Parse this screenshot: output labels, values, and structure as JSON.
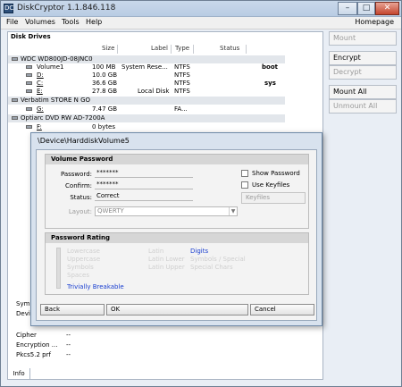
{
  "window": {
    "title": "DiskCryptor 1.1.846.118",
    "icon": "DC",
    "minimize": "–",
    "maximize": "□",
    "close": "✕"
  },
  "menu": {
    "items": [
      "File",
      "Volumes",
      "Tools",
      "Help"
    ],
    "homepage": "Homepage"
  },
  "drives": {
    "label": "Disk Drives",
    "columns": {
      "size": "Size",
      "label": "Label",
      "type": "Type",
      "status": "Status"
    },
    "groups": [
      {
        "name": "WDC WD800JD-08JNC0",
        "volumes": [
          {
            "name": "Volume1",
            "size": "100 MB",
            "label": "System Rese...",
            "type": "NTFS",
            "flag": "boot"
          },
          {
            "name": "D:",
            "size": "10.0 GB",
            "label": "",
            "type": "NTFS",
            "flag": ""
          },
          {
            "name": "C:",
            "size": "36.6 GB",
            "label": "",
            "type": "NTFS",
            "flag": "sys"
          },
          {
            "name": "E:",
            "size": "27.8 GB",
            "label": "Local Disk",
            "type": "NTFS",
            "flag": ""
          }
        ]
      },
      {
        "name": "Verbatim STORE N GO",
        "volumes": [
          {
            "name": "G:",
            "size": "7.47 GB",
            "label": "",
            "type": "FA...",
            "flag": ""
          }
        ]
      },
      {
        "name": "Optiarc DVD RW AD-7200A",
        "volumes": [
          {
            "name": "F:",
            "size": "0 bytes",
            "label": "",
            "type": "",
            "flag": ""
          }
        ]
      }
    ]
  },
  "sidebar": {
    "mount": "Mount",
    "encrypt": "Encrypt",
    "decrypt": "Decrypt",
    "mount_all": "Mount All",
    "unmount_all": "Unmount All"
  },
  "info": {
    "symbolic": "Symb",
    "device": "Devic",
    "cipher": "Cipher",
    "encryption": "Encryption ...",
    "pkcs": "Pkcs5.2 prf",
    "dash": "--",
    "tab": "Info"
  },
  "dialog": {
    "title": "\\Device\\HarddiskVolume5",
    "volume_password": {
      "header": "Volume Password",
      "password_label": "Password:",
      "password_value": "*******",
      "confirm_label": "Confirm:",
      "confirm_value": "*******",
      "status_label": "Status:",
      "status_value": "Correct",
      "layout_label": "Layout:",
      "layout_value": "QWERTY",
      "show_password": "Show Password",
      "use_keyfiles": "Use Keyfiles",
      "keyfiles_button": "Keyfiles"
    },
    "password_rating": {
      "header": "Password Rating",
      "digits": "Digits",
      "rating": "Trivially Breakable",
      "faint_left": [
        "Lowercase",
        "Uppercase",
        "Symbols",
        "Spaces"
      ],
      "faint_mid": [
        "Latin",
        "Latin Lower",
        "Latin Upper"
      ],
      "faint_right": [
        "Symbols / Special",
        "Special Chars"
      ]
    },
    "buttons": {
      "back": "Back",
      "ok": "OK",
      "cancel": "Cancel"
    }
  }
}
